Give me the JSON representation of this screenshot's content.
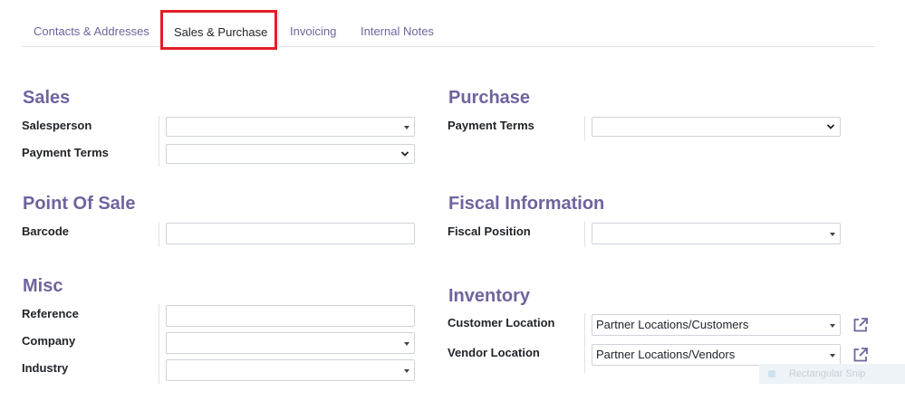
{
  "tabs": [
    {
      "label": "Contacts & Addresses",
      "active": false
    },
    {
      "label": "Sales & Purchase",
      "active": true
    },
    {
      "label": "Invoicing",
      "active": false
    },
    {
      "label": "Internal Notes",
      "active": false
    }
  ],
  "sales": {
    "title": "Sales",
    "salesperson_label": "Salesperson",
    "salesperson_value": "",
    "payment_terms_label": "Payment Terms",
    "payment_terms_value": ""
  },
  "purchase": {
    "title": "Purchase",
    "payment_terms_label": "Payment Terms",
    "payment_terms_value": ""
  },
  "point_of_sale": {
    "title": "Point Of Sale",
    "barcode_label": "Barcode",
    "barcode_value": ""
  },
  "fiscal": {
    "title": "Fiscal Information",
    "fiscal_position_label": "Fiscal Position",
    "fiscal_position_value": ""
  },
  "misc": {
    "title": "Misc",
    "reference_label": "Reference",
    "reference_value": "",
    "company_label": "Company",
    "company_value": "",
    "industry_label": "Industry",
    "industry_value": ""
  },
  "inventory": {
    "title": "Inventory",
    "customer_location_label": "Customer Location",
    "customer_location_value": "Partner Locations/Customers",
    "vendor_location_label": "Vendor Location",
    "vendor_location_value": "Partner Locations/Vendors"
  },
  "overlay": {
    "snip_label": "Rectangular Snip"
  },
  "colors": {
    "accent": "#71639e",
    "highlight": "#e11f26",
    "border": "#ced4da"
  }
}
